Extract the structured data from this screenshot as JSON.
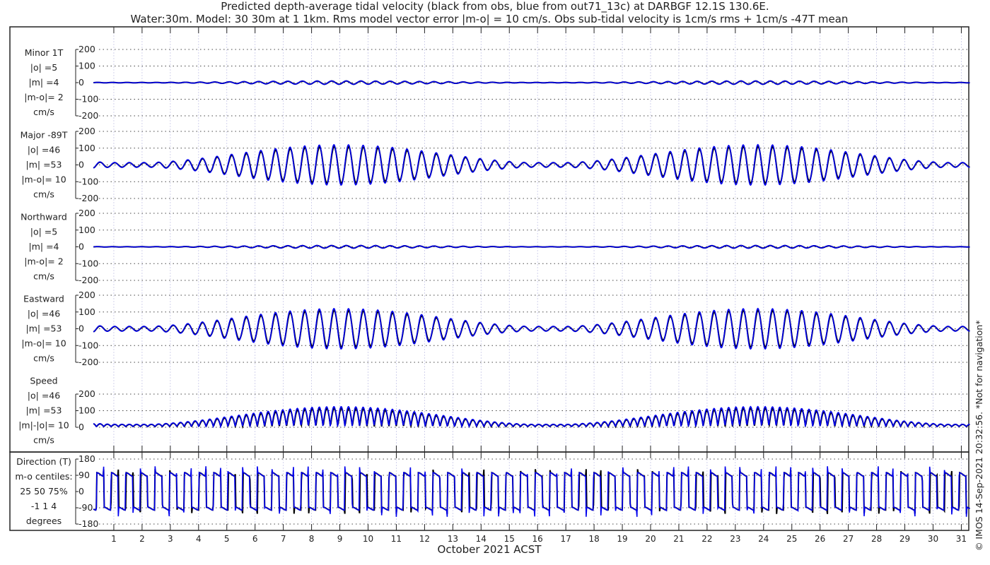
{
  "chart_data": {
    "type": "line",
    "title": [
      "Predicted depth-average tidal velocity (black from obs, blue from out71_13c) at DARBGF 12.1S 130.6E.",
      "Water:30m. Model: 30 30m at 1 1km. Rms model vector error |m-o| = 10 cm/s. Obs sub-tidal velocity is 1cm/s rms + 1cm/s -47T mean"
    ],
    "xlabel": "October 2021 ACST",
    "xticks": [
      "1",
      "2",
      "3",
      "4",
      "5",
      "6",
      "7",
      "8",
      "9",
      "10",
      "11",
      "12",
      "13",
      "14",
      "15",
      "16",
      "17",
      "18",
      "19",
      "20",
      "21",
      "22",
      "23",
      "24",
      "25",
      "26",
      "27",
      "28",
      "29",
      "30",
      "31"
    ],
    "xlim": [
      0.28,
      31.3
    ],
    "series_names": [
      "obs",
      "model"
    ],
    "series_colors": {
      "obs": "#000000",
      "model": "#0000ee"
    },
    "panels": [
      {
        "key": "minor",
        "labels": [
          "Minor 1T",
          "|o| =5",
          "|m| =4",
          "|m-o|= 2",
          "cm/s"
        ],
        "yticks": [
          "200",
          "100",
          "0",
          "-100",
          "-200"
        ],
        "ylim": [
          -200,
          200
        ],
        "amplitude_max": 10
      },
      {
        "key": "major",
        "labels": [
          "Major -89T",
          "|o| =46",
          "|m| =53",
          "|m-o|= 10",
          "cm/s"
        ],
        "yticks": [
          "200",
          "100",
          "0",
          "-100",
          "-200"
        ],
        "ylim": [
          -200,
          200
        ],
        "amplitude_max": 115
      },
      {
        "key": "north",
        "labels": [
          "Northward",
          "|o| =5",
          "|m| =4",
          "|m-o|= 2",
          "cm/s"
        ],
        "yticks": [
          "200",
          "100",
          "0",
          "-100",
          "-200"
        ],
        "ylim": [
          -200,
          200
        ],
        "amplitude_max": 8
      },
      {
        "key": "east",
        "labels": [
          "Eastward",
          "|o| =46",
          "|m| =53",
          "|m-o|= 10",
          "cm/s"
        ],
        "yticks": [
          "200",
          "100",
          "0",
          "-100",
          "-200"
        ],
        "ylim": [
          -200,
          200
        ],
        "amplitude_max": 115
      },
      {
        "key": "speed",
        "labels": [
          "Speed",
          "|o| =46",
          "|m| =53",
          "|m|-|o|= 10",
          "cm/s"
        ],
        "yticks": [
          "200",
          "100",
          "0"
        ],
        "ylim": [
          0,
          200
        ],
        "amplitude_max": 115
      },
      {
        "key": "direction",
        "labels": [
          "Direction (T)",
          "m-o centiles:",
          "25  50  75%",
          "-1  1  4",
          "degrees"
        ],
        "yticks": [
          "180",
          "90",
          "0",
          "-90",
          "-180"
        ],
        "ylim": [
          -180,
          180
        ]
      }
    ]
  },
  "footer": "© IMOS 14-Sep-2021 20:32:56. *Not for navigation*"
}
